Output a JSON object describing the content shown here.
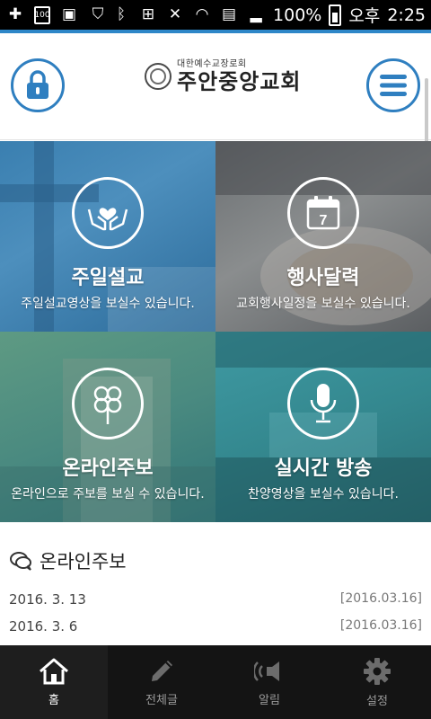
{
  "status_bar": {
    "battery_percent": "100%",
    "ampm": "오후",
    "time": "2:25",
    "box_label": "100"
  },
  "header": {
    "logo_subtitle": "대한예수교장로회",
    "logo_title": "주안중앙교회"
  },
  "tiles": [
    {
      "title": "주일설교",
      "description": "주일설교영상을 보실수 있습니다.",
      "icon": "heart-hands-icon"
    },
    {
      "title": "행사달력",
      "description": "교회행사일정을 보실수 있습니다.",
      "icon": "calendar-icon",
      "calendar_number": "7"
    },
    {
      "title": "온라인주보",
      "description": "온라인으로 주보를 보실 수 있습니다.",
      "icon": "flower-icon"
    },
    {
      "title": "실시간 방송",
      "description": "찬양영상을 보실수 있습니다.",
      "icon": "microphone-icon"
    }
  ],
  "bulletin": {
    "title": "온라인주보",
    "items": [
      {
        "title": "2016. 3. 13",
        "date": "[2016.03.16]"
      },
      {
        "title": "2016. 3. 6",
        "date": "[2016.03.16]"
      }
    ]
  },
  "nav": [
    {
      "label": "홈",
      "icon": "home-icon",
      "active": true
    },
    {
      "label": "전체글",
      "icon": "pencil-icon",
      "active": false
    },
    {
      "label": "알림",
      "icon": "speaker-icon",
      "active": false
    },
    {
      "label": "설정",
      "icon": "gear-icon",
      "active": false
    }
  ],
  "colors": {
    "accent": "#2f7fc0",
    "nav_bg": "#141414"
  }
}
